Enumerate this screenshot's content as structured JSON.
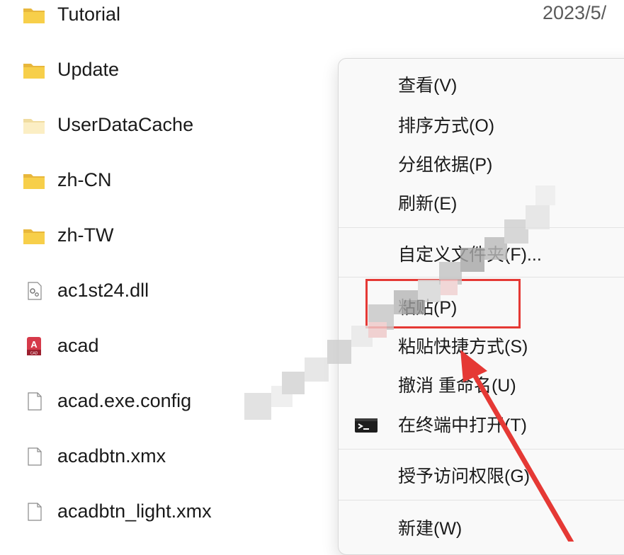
{
  "files": [
    {
      "name": "Tutorial",
      "type": "folder",
      "date": "2023/5/"
    },
    {
      "name": "Update",
      "type": "folder"
    },
    {
      "name": "UserDataCache",
      "type": "folder-light"
    },
    {
      "name": "zh-CN",
      "type": "folder"
    },
    {
      "name": "zh-TW",
      "type": "folder"
    },
    {
      "name": "ac1st24.dll",
      "type": "dll"
    },
    {
      "name": "acad",
      "type": "acad"
    },
    {
      "name": "acad.exe.config",
      "type": "file"
    },
    {
      "name": "acadbtn.xmx",
      "type": "file"
    },
    {
      "name": "acadbtn_light.xmx",
      "type": "file"
    }
  ],
  "context_menu": {
    "items": [
      {
        "label": "查看(V)"
      },
      {
        "label": "排序方式(O)"
      },
      {
        "label": "分组依据(P)"
      },
      {
        "label": "刷新(E)"
      },
      {
        "label": "自定义文件夹(F)..."
      },
      {
        "label": "粘贴(P)"
      },
      {
        "label": "粘贴快捷方式(S)"
      },
      {
        "label": "撤消 重命名(U)"
      },
      {
        "label": "在终端中打开(T)",
        "icon": "terminal-icon"
      },
      {
        "label": "授予访问权限(G)"
      },
      {
        "label": "新建(W)"
      }
    ]
  },
  "annotation": {
    "highlight_color": "#e53935",
    "arrow_color": "#e53935"
  }
}
